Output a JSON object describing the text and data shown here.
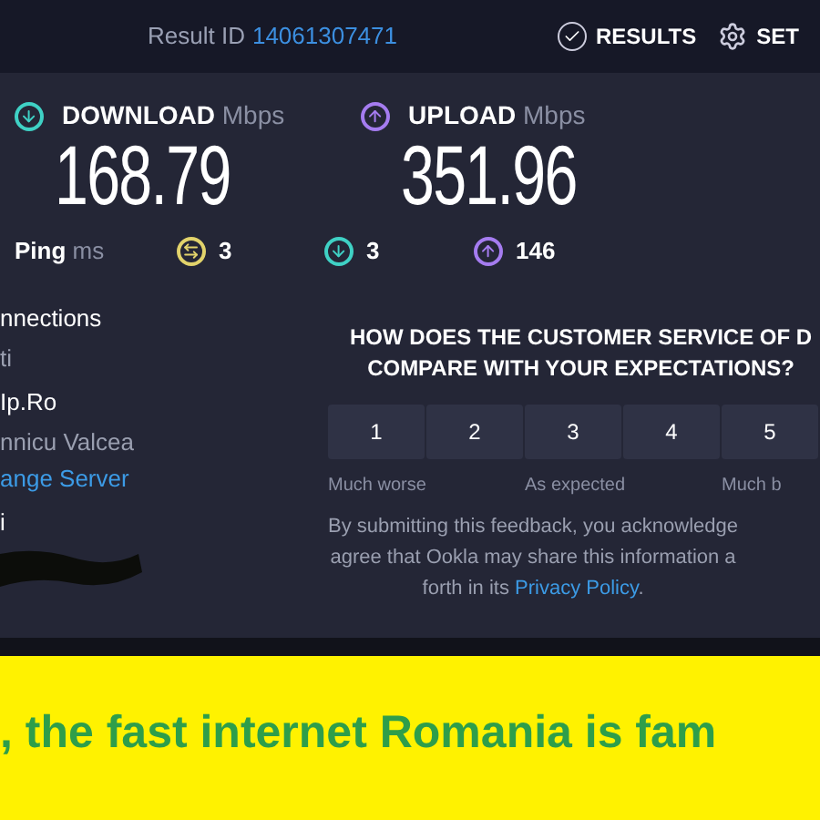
{
  "header": {
    "result_label": "Result ID",
    "result_id": "14061307471",
    "nav": [
      {
        "kind": "check",
        "label": "RESULTS"
      },
      {
        "kind": "gear",
        "label": "SET"
      }
    ]
  },
  "speeds": [
    {
      "kind": "download",
      "label": "DOWNLOAD",
      "unit": "Mbps",
      "value": "168.79"
    },
    {
      "kind": "upload",
      "label": "UPLOAD",
      "unit": "Mbps",
      "value": "351.96"
    }
  ],
  "ping": {
    "label": "Ping",
    "unit": "ms",
    "items": [
      {
        "kind": "idle",
        "value": "3"
      },
      {
        "kind": "download",
        "value": "3"
      },
      {
        "kind": "upload",
        "value": "146"
      }
    ]
  },
  "connection": [
    {
      "kind": "heading",
      "text": "nnections"
    },
    {
      "kind": "detail",
      "text": "ti"
    },
    {
      "kind": "heading",
      "text": "Ip.Ro"
    },
    {
      "kind": "detail",
      "text": "nnicu Valcea"
    },
    {
      "kind": "link",
      "text": "ange Server"
    },
    {
      "kind": "heading",
      "text": "i"
    },
    {
      "kind": "redacted"
    }
  ],
  "survey": {
    "question": [
      "HOW DOES THE CUSTOMER SERVICE OF D",
      "COMPARE WITH YOUR EXPECTATIONS?"
    ],
    "ratings": [
      "1",
      "2",
      "3",
      "4",
      "5"
    ],
    "scale_labels": [
      {
        "kind": "low",
        "text": "Much worse"
      },
      {
        "kind": "middle",
        "text": "As expected"
      },
      {
        "kind": "high",
        "text": "Much b"
      }
    ],
    "disclaimer": [
      "By submitting this feedback, you acknowledge",
      "agree that Ookla may share this information a",
      "forth in its"
    ],
    "privacy_link": "Privacy Policy",
    "end": "."
  },
  "banner": {
    "text": ", the fast internet Romania is fam"
  }
}
